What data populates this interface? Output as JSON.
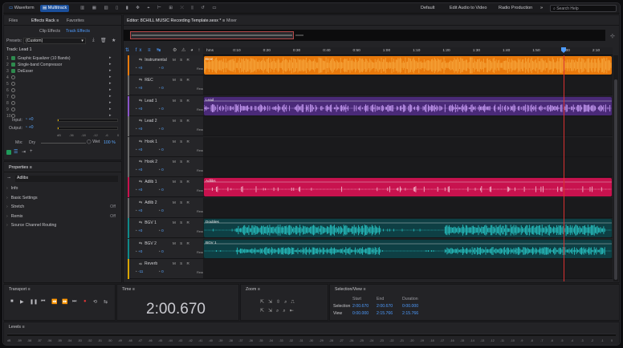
{
  "topbar": {
    "view_waveform": "Waveform",
    "view_multitrack": "Multitrack",
    "workspaces": [
      "Default",
      "Edit Audio to Video",
      "Radio Production"
    ],
    "search_placeholder": "Search Help"
  },
  "left_tabs": {
    "files": "Files",
    "effects_rack": "Effects Rack",
    "favorites": "Favorites"
  },
  "rack_subtabs": {
    "clip_effects": "Clip Effects",
    "track_effects": "Track Effects"
  },
  "presets": {
    "label": "Presets:",
    "value": "(Custom)"
  },
  "track_label": "Track: Lead 1",
  "effects": [
    {
      "n": "1",
      "name": "Graphic Equalizer (10 Bands)",
      "on": true
    },
    {
      "n": "2",
      "name": "Single-band Compressor",
      "on": true
    },
    {
      "n": "3",
      "name": "DeEsser",
      "on": true
    },
    {
      "n": "4",
      "name": "",
      "on": false
    },
    {
      "n": "5",
      "name": "",
      "on": false
    },
    {
      "n": "6",
      "name": "",
      "on": false
    },
    {
      "n": "7",
      "name": "",
      "on": false
    },
    {
      "n": "8",
      "name": "",
      "on": false
    },
    {
      "n": "9",
      "name": "",
      "on": false
    },
    {
      "n": "10",
      "name": "",
      "on": false
    }
  ],
  "io": {
    "input_label": "Input:",
    "input_val": "+0",
    "output_label": "Output:",
    "output_val": "+0"
  },
  "meter_scale": [
    "dB",
    "-36",
    "-18",
    "-12",
    "-6",
    "0"
  ],
  "mix": {
    "label": "Mix:",
    "dry": "Dry",
    "wet": "Wet",
    "pct": "100 %"
  },
  "properties": {
    "title": "Properties",
    "clip_name": "Adlibs",
    "rows": [
      {
        "label": "Info",
        "value": ""
      },
      {
        "label": "Basic Settings",
        "value": ""
      },
      {
        "label": "Stretch",
        "value": "Off"
      },
      {
        "label": "Remix",
        "value": "Off"
      },
      {
        "label": "Source Channel Routing",
        "value": ""
      }
    ]
  },
  "editor": {
    "tab": "Editor: 8CHILL MUSIC Recording Template.sesx *",
    "mixer": "Mixer"
  },
  "ruler": [
    "hms",
    "0:10",
    "0:20",
    "0:30",
    "0:40",
    "0:50",
    "1:00",
    "1:10",
    "1:20",
    "1:30",
    "1:40",
    "1:50",
    "2:00",
    "2:10"
  ],
  "tracks": [
    {
      "name": "Instrumental",
      "vol": "+0",
      "pan": "0",
      "clip": "Beat"
    },
    {
      "name": "REC",
      "vol": "+0",
      "pan": "0",
      "clip": ""
    },
    {
      "name": "Lead 1",
      "vol": "+0",
      "pan": "0",
      "clip": "Lead"
    },
    {
      "name": "Lead 2",
      "vol": "+0",
      "pan": "0",
      "clip": ""
    },
    {
      "name": "Hook 1",
      "vol": "+0",
      "pan": "0",
      "clip": ""
    },
    {
      "name": "Hook 2",
      "vol": "+0",
      "pan": "0",
      "clip": ""
    },
    {
      "name": "Adlib 1",
      "vol": "+0",
      "pan": "0",
      "clip": "Adlibs"
    },
    {
      "name": "Adlib 2",
      "vol": "+0",
      "pan": "0",
      "clip": ""
    },
    {
      "name": "BGV 1",
      "vol": "+0",
      "pan": "0",
      "clip": "Doubles"
    },
    {
      "name": "BGV 2",
      "vol": "+0",
      "pan": "0",
      "clip": "BGV 1"
    },
    {
      "name": "Reverb",
      "vol": "-11",
      "pan": "0",
      "clip": ""
    }
  ],
  "track_colors": {
    "instrumental": "#e8790c",
    "lead": "#8a55c9",
    "adlib": "#c8124e",
    "bgv": "#0f8a8a",
    "reverb": "#d8a400"
  },
  "msr": "M S R",
  "read": "Read",
  "transport": {
    "title": "Transport"
  },
  "time": {
    "title": "Time",
    "value": "2:00.670"
  },
  "zoom": {
    "title": "Zoom"
  },
  "selection": {
    "title": "Selection/View",
    "start_label": "Start",
    "end_label": "End",
    "duration_label": "Duration",
    "selection_label": "Selection",
    "view_label": "View",
    "sel_start": "2:00.670",
    "sel_end": "2:00.670",
    "sel_dur": "0:00.000",
    "view_start": "0:00.000",
    "view_end": "2:15.766",
    "view_dur": "2:15.766"
  },
  "levels": {
    "title": "Levels",
    "scale": [
      "dB",
      "-59",
      "-58",
      "-57",
      "-56",
      "-55",
      "-54",
      "-53",
      "-52",
      "-51",
      "-50",
      "-49",
      "-48",
      "-47",
      "-46",
      "-45",
      "-44",
      "-43",
      "-42",
      "-41",
      "-40",
      "-39",
      "-38",
      "-37",
      "-36",
      "-35",
      "-34",
      "-33",
      "-32",
      "-31",
      "-30",
      "-29",
      "-28",
      "-27",
      "-26",
      "-25",
      "-24",
      "-23",
      "-22",
      "-21",
      "-20",
      "-19",
      "-18",
      "-17",
      "-16",
      "-15",
      "-14",
      "-13",
      "-12",
      "-11",
      "-10",
      "-9",
      "-8",
      "-7",
      "-6",
      "-5",
      "-4",
      "-3",
      "-2",
      "-1",
      "0"
    ]
  }
}
